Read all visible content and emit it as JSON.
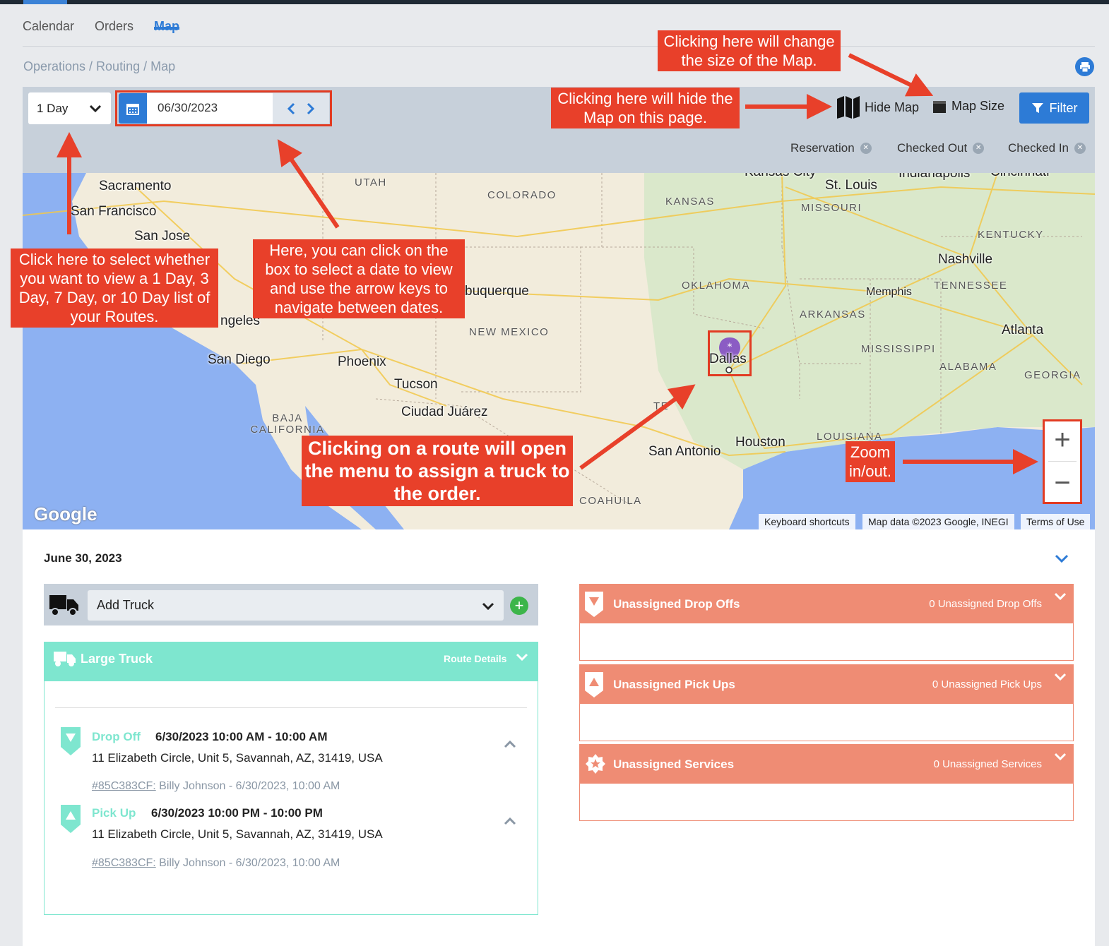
{
  "tabs": [
    {
      "label": "Calendar"
    },
    {
      "label": "Orders"
    },
    {
      "label": "Map"
    }
  ],
  "breadcrumb": "Operations / Routing / Map",
  "toolbar": {
    "day_select": "1 Day",
    "date": "06/30/2023",
    "hide_map": "Hide Map",
    "map_size": "Map Size",
    "filter": "Filter"
  },
  "legend": [
    "Reservation",
    "Checked Out",
    "Checked In"
  ],
  "map": {
    "cities": [
      "Sacramento",
      "San Francisco",
      "San Jose",
      "San Diego",
      "Phoenix",
      "Tucson",
      "Ciudad Juárez",
      "St. Louis",
      "Nashville",
      "Memphis",
      "Atlanta",
      "Dallas",
      "Houston",
      "San Antonio",
      "Kansas City",
      "Indianapolis",
      "Cincinnati",
      "buquerque",
      "ngeles"
    ],
    "states": [
      "UTAH",
      "COLORADO",
      "KANSAS",
      "MISSOURI",
      "KENTUCKY",
      "TENNESSEE",
      "OKLAHOMA",
      "ARKANSAS",
      "NEW MEXICO",
      "MISSISSIPPI",
      "ALABAMA",
      "GEORGIA",
      "LOUISIANA",
      "BAJA CALIFORNIA",
      "COAHUILA",
      "TE"
    ],
    "logo": "Google",
    "footer": [
      "Keyboard shortcuts",
      "Map data ©2023 Google, INEGI",
      "Terms of Use"
    ]
  },
  "callouts": {
    "map_size": "Clicking here will change the size of the Map.",
    "hide_map": "Clicking here will hide the Map on this page.",
    "day_select": "Click here to select whether you want to view a 1 Day, 3 Day, 7 Day, or 10 Day list of your Routes.",
    "date": "Here, you can click on the box to select a date to view and use the arrow keys to navigate between dates.",
    "route": "Clicking on a route will open the menu to assign a truck to the order.",
    "zoom": "Zoom in/out."
  },
  "schedule": {
    "date_title": "June 30, 2023",
    "add_truck": "Add Truck",
    "truck": {
      "name": "Large Truck",
      "route_details": "Route Details",
      "stops": [
        {
          "type": "Drop Off",
          "time": "6/30/2023  10:00 AM - 10:00 AM",
          "address": "11 Elizabeth Circle, Unit 5, Savannah, AZ, 31419, USA",
          "order": "#85C383CF:",
          "customer": "Billy Johnson - 6/30/2023, 10:00 AM"
        },
        {
          "type": "Pick Up",
          "time": "6/30/2023  10:00 PM - 10:00 PM",
          "address": "11 Elizabeth Circle, Unit 5, Savannah, AZ, 31419, USA",
          "order": "#85C383CF:",
          "customer": "Billy Johnson - 6/30/2023, 10:00 AM"
        }
      ]
    },
    "unassigned": [
      {
        "title": "Unassigned Drop Offs",
        "count": "0 Unassigned Drop Offs"
      },
      {
        "title": "Unassigned Pick Ups",
        "count": "0 Unassigned Pick Ups"
      },
      {
        "title": "Unassigned Services",
        "count": "0 Unassigned Services"
      }
    ]
  },
  "colors": {
    "accent": "#2d7bd6",
    "callout": "#e8402a",
    "truck": "#7ee6cf",
    "unassigned": "#ef8c74",
    "pin": "#8b5cc4"
  }
}
